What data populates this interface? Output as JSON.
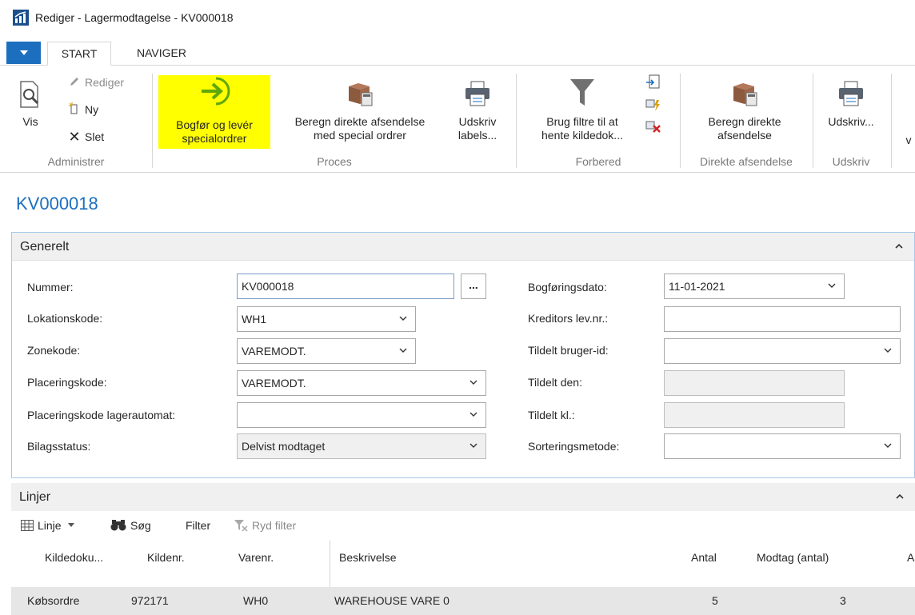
{
  "window": {
    "title": "Rediger - Lagermodtagelse - KV000018"
  },
  "tabs": {
    "start": "START",
    "navigate": "NAVIGER"
  },
  "ribbon": {
    "administrer": {
      "label": "Administrer",
      "view": "Vis",
      "edit": "Rediger",
      "new": "Ny",
      "delete": "Slet"
    },
    "proces": {
      "label": "Proces",
      "post_line1": "Bogfør og levér",
      "post_line2": "specialordrer",
      "calc_line1": "Beregn direkte afsendelse",
      "calc_line2": "med special ordrer",
      "print_line1": "Udskriv",
      "print_line2": "labels..."
    },
    "forbered": {
      "label": "Forbered",
      "filter_line1": "Brug filtre til at",
      "filter_line2": "hente kildedok..."
    },
    "direkte": {
      "label": "Direkte afsendelse",
      "calc_line1": "Beregn direkte",
      "calc_line2": "afsendelse"
    },
    "udskriv": {
      "label": "Udskriv",
      "print": "Udskriv..."
    },
    "cut_off": "v"
  },
  "doc_title": "KV000018",
  "general": {
    "header": "Generelt",
    "fields": {
      "nummer": {
        "label": "Nummer:",
        "value": "KV000018"
      },
      "lokationskode": {
        "label": "Lokationskode:",
        "value": "WH1"
      },
      "zonekode": {
        "label": "Zonekode:",
        "value": "VAREMODT."
      },
      "placeringskode": {
        "label": "Placeringskode:",
        "value": "VAREMODT."
      },
      "placeringskode_auto": {
        "label": "Placeringskode lagerautomat:",
        "value": ""
      },
      "bilagsstatus": {
        "label": "Bilagsstatus:",
        "value": "Delvist modtaget"
      },
      "bogforingsdato": {
        "label": "Bogføringsdato:",
        "value": "11-01-2021"
      },
      "kreditor": {
        "label": "Kreditors lev.nr.:",
        "value": ""
      },
      "tildelt_bruger": {
        "label": "Tildelt bruger-id:",
        "value": ""
      },
      "tildelt_den": {
        "label": "Tildelt den:",
        "value": ""
      },
      "tildelt_kl": {
        "label": "Tildelt kl.:",
        "value": ""
      },
      "sortering": {
        "label": "Sorteringsmetode:",
        "value": ""
      }
    },
    "dots": "..."
  },
  "lines": {
    "header": "Linjer",
    "toolbar": {
      "line": "Linje",
      "search": "Søg",
      "filter": "Filter",
      "clear_filter": "Ryd filter"
    },
    "columns": [
      "Kildedoku...",
      "Kildenr.",
      "Varenr.",
      "Beskrivelse",
      "Antal",
      "Modtag (antal)",
      "A"
    ],
    "rows": [
      [
        "Købsordre",
        "972171",
        "WH0",
        "WAREHOUSE VARE 0",
        "5",
        "3"
      ]
    ]
  },
  "colors": {
    "accent": "#1c6fbf",
    "highlight": "#ffff00",
    "post_icon": "#5fa80c"
  }
}
